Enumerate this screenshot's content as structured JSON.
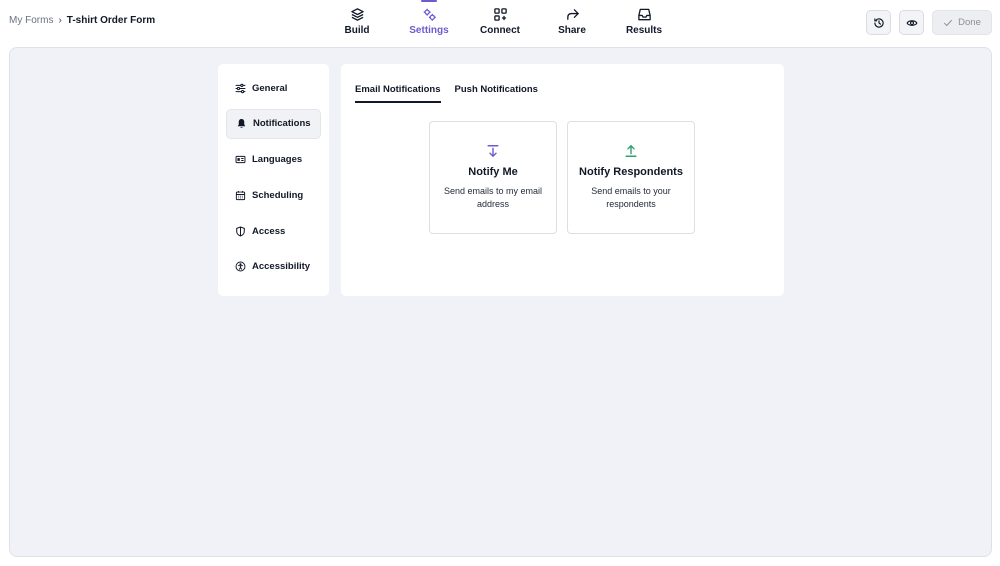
{
  "breadcrumb": {
    "root": "My Forms",
    "separator": "›",
    "current": "T-shirt Order Form"
  },
  "nav": {
    "tabs": [
      {
        "label": "Build",
        "icon": "layers-icon"
      },
      {
        "label": "Settings",
        "icon": "gears-icon",
        "active": true
      },
      {
        "label": "Connect",
        "icon": "apps-plus-icon"
      },
      {
        "label": "Share",
        "icon": "share-arrow-icon"
      },
      {
        "label": "Results",
        "icon": "inbox-icon"
      }
    ]
  },
  "actions": {
    "history_icon": "history-icon",
    "preview_icon": "eye-icon",
    "done_label": "Done"
  },
  "sidebar": {
    "items": [
      {
        "label": "General",
        "icon": "sliders-icon"
      },
      {
        "label": "Notifications",
        "icon": "bell-icon",
        "active": true
      },
      {
        "label": "Languages",
        "icon": "language-card-icon"
      },
      {
        "label": "Scheduling",
        "icon": "calendar-icon"
      },
      {
        "label": "Access",
        "icon": "shield-icon"
      },
      {
        "label": "Accessibility",
        "icon": "accessibility-icon"
      }
    ]
  },
  "subtabs": [
    {
      "label": "Email Notifications",
      "active": true
    },
    {
      "label": "Push Notifications"
    }
  ],
  "options": [
    {
      "title": "Notify Me",
      "desc": "Send emails to my email address",
      "icon": "arrow-down-to-line-icon"
    },
    {
      "title": "Notify Respondents",
      "desc": "Send emails to your respondents",
      "icon": "arrow-up-from-line-icon"
    }
  ],
  "colors": {
    "accent": "#6d5bd0",
    "respondent_green": "#2f9e72",
    "canvas_bg": "#f1f2f7"
  }
}
